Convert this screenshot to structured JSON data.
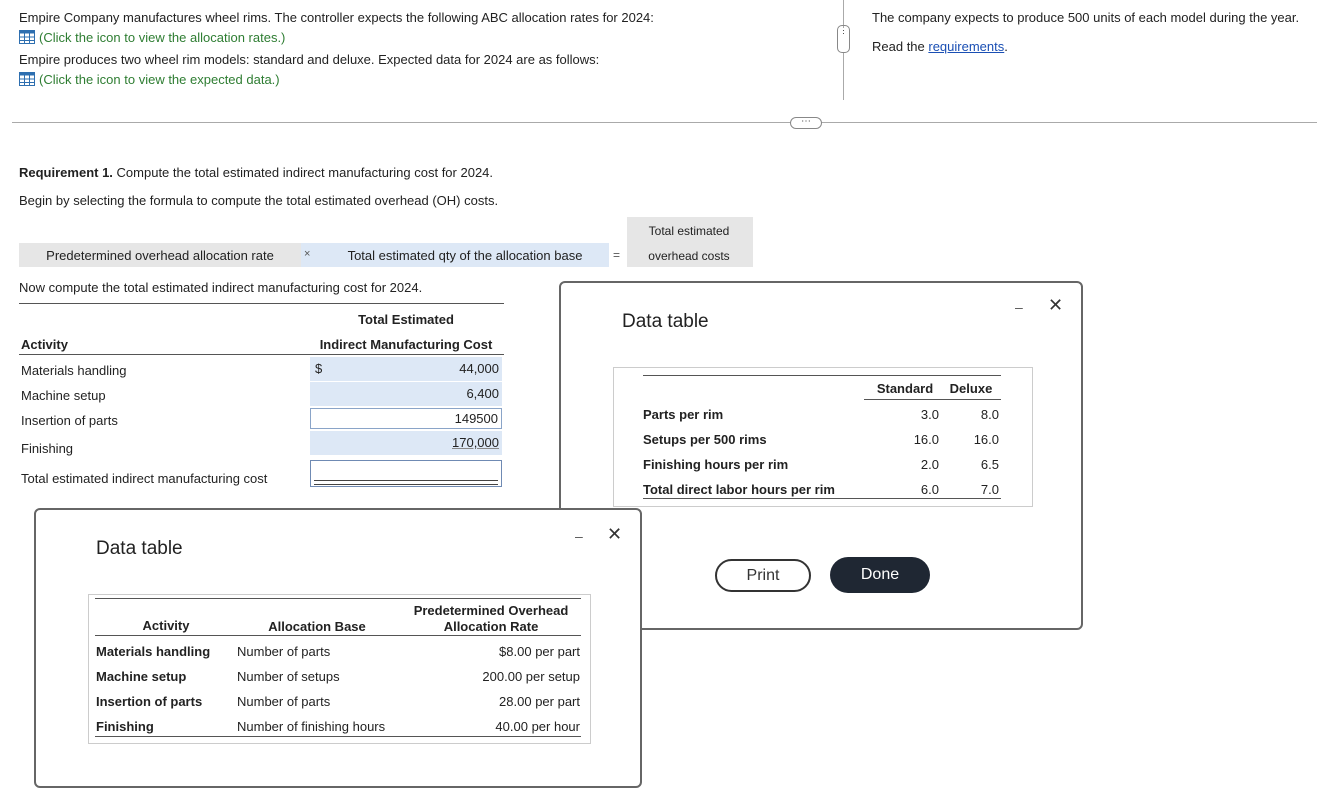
{
  "intro": {
    "line1": "Empire Company manufactures wheel rims. The controller expects the following ABC allocation rates for 2024:",
    "link1": "(Click the icon to view the allocation rates.)",
    "line2": "Empire produces two wheel rim models: standard and deluxe. Expected data for 2024 are as follows:",
    "link2": "(Click the icon to view the expected data.)"
  },
  "right_panel": {
    "text1": "The company expects to produce 500 units of each model during the year.",
    "read_prefix": "Read the ",
    "read_link": "requirements",
    "read_suffix": "."
  },
  "requirement": {
    "label": "Requirement 1.",
    "text": " Compute the total estimated indirect manufacturing cost for 2024.",
    "begin": "Begin by selecting the formula to compute the total estimated overhead (OH) costs."
  },
  "formula": {
    "term1": "Predetermined overhead allocation rate",
    "op1": "×",
    "term2": "Total estimated qty of the allocation base",
    "op2": "=",
    "result_line1": "Total estimated",
    "result_line2": "overhead costs"
  },
  "compute": {
    "instruction": "Now compute the total estimated indirect manufacturing cost for 2024.",
    "col_header1": "Total Estimated",
    "col_header2": "Indirect Manufacturing Cost",
    "activity_header": "Activity",
    "rows": [
      {
        "activity": "Materials handling",
        "currency": "$",
        "value": "44,000"
      },
      {
        "activity": "Machine setup",
        "currency": "",
        "value": "6,400"
      },
      {
        "activity": "Insertion of parts",
        "currency": "",
        "value": "149500"
      },
      {
        "activity": "Finishing",
        "currency": "",
        "value": "170,000"
      }
    ],
    "total_label": "Total estimated indirect manufacturing cost",
    "total_value": ""
  },
  "dialog_expected": {
    "title": "Data table",
    "col_standard": "Standard",
    "col_deluxe": "Deluxe",
    "rows": [
      {
        "label": "Parts per rim",
        "standard": "3.0",
        "deluxe": "8.0"
      },
      {
        "label": "Setups per 500 rims",
        "standard": "16.0",
        "deluxe": "16.0"
      },
      {
        "label": "Finishing hours per rim",
        "standard": "2.0",
        "deluxe": "6.5"
      },
      {
        "label": "Total direct labor hours per rim",
        "standard": "6.0",
        "deluxe": "7.0"
      }
    ],
    "print_label": "Print",
    "done_label": "Done",
    "minimize": "–",
    "close": "✕"
  },
  "dialog_rates": {
    "title": "Data table",
    "col_activity": "Activity",
    "col_base": "Allocation Base",
    "col_rate1": "Predetermined Overhead",
    "col_rate2": "Allocation Rate",
    "rows": [
      {
        "activity": "Materials handling",
        "base": "Number of parts",
        "rate": "$8.00 per part"
      },
      {
        "activity": "Machine setup",
        "base": "Number of setups",
        "rate": "200.00 per setup"
      },
      {
        "activity": "Insertion of parts",
        "base": "Number of parts",
        "rate": "28.00 per part"
      },
      {
        "activity": "Finishing",
        "base": "Number of finishing hours",
        "rate": "40.00 per hour"
      }
    ],
    "minimize": "–",
    "close": "✕"
  },
  "colors": {
    "link_green": "#2e7d32",
    "link_blue": "#1a4fb4",
    "highlight_blue": "#dde8f6",
    "formula_gray": "#e6e6e6",
    "done_bg": "#1f2733"
  },
  "splitter_handle": "⋯"
}
